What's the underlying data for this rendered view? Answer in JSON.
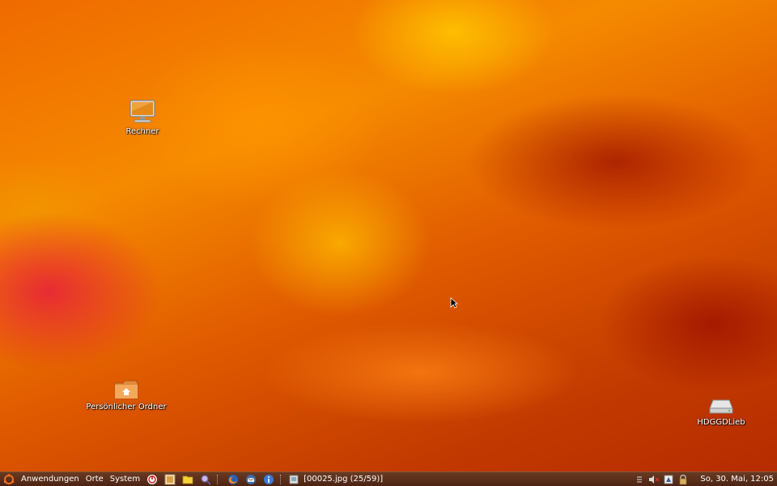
{
  "desktop": {
    "icons": [
      {
        "label": "Rechner",
        "icon": "computer-icon"
      },
      {
        "label": "Persönlicher Ordner",
        "icon": "home-folder-icon"
      },
      {
        "label": "HDGGDLieb",
        "icon": "drive-icon"
      }
    ]
  },
  "panel": {
    "menus": {
      "applications": "Anwendungen",
      "places": "Orte",
      "system": "System"
    },
    "launchers": [
      "shutdown-icon",
      "terminal-icon",
      "folder-icon",
      "search-icon",
      "firefox-icon",
      "thunderbird-icon",
      "info-icon"
    ],
    "task": {
      "title": "[00025.jpg  (25/59)]"
    },
    "tray": [
      "network-icon",
      "volume-muted-icon",
      "display-icon",
      "lock-icon"
    ],
    "clock": "So, 30. Mai, 12:05"
  },
  "colors": {
    "panel": "#5a2e1a",
    "accent": "#f08000"
  }
}
